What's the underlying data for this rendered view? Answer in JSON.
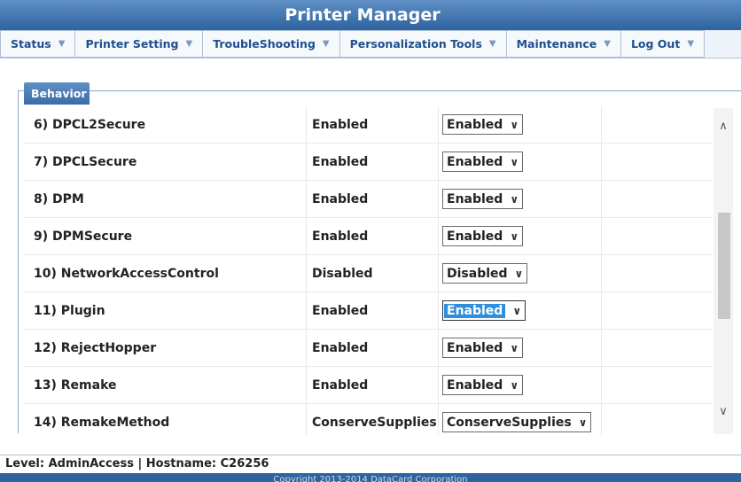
{
  "app": {
    "title": "Printer Manager"
  },
  "menu": [
    {
      "label": "Status"
    },
    {
      "label": "Printer Setting"
    },
    {
      "label": "TroubleShooting"
    },
    {
      "label": "Personalization Tools"
    },
    {
      "label": "Maintenance"
    },
    {
      "label": "Log Out"
    }
  ],
  "panel": {
    "tab_label": "Behavior"
  },
  "rows": [
    {
      "name": "6) DPCL2Secure",
      "value": "Enabled",
      "selected": "Enabled"
    },
    {
      "name": "7) DPCLSecure",
      "value": "Enabled",
      "selected": "Enabled"
    },
    {
      "name": "8) DPM",
      "value": "Enabled",
      "selected": "Enabled"
    },
    {
      "name": "9) DPMSecure",
      "value": "Enabled",
      "selected": "Enabled"
    },
    {
      "name": "10) NetworkAccessControl",
      "value": "Disabled",
      "selected": "Disabled"
    },
    {
      "name": "11) Plugin",
      "value": "Enabled",
      "selected": "Enabled"
    },
    {
      "name": "12) RejectHopper",
      "value": "Enabled",
      "selected": "Enabled"
    },
    {
      "name": "13) Remake",
      "value": "Enabled",
      "selected": "Enabled"
    },
    {
      "name": "14) RemakeMethod",
      "value": "ConserveSupplies",
      "selected": "ConserveSupplies"
    }
  ],
  "status": {
    "text": "Level: AdminAccess | Hostname: C26256"
  },
  "footer": {
    "text": "Copyright 2013-2014 DataCard Corporation"
  },
  "colors": {
    "header": "#2e63a0",
    "menu_text": "#1e4f8f",
    "focus": "#2f8fdd"
  },
  "icons": {
    "menu_caret": "caret-down-icon",
    "select_chevron": "chevron-down-icon"
  }
}
